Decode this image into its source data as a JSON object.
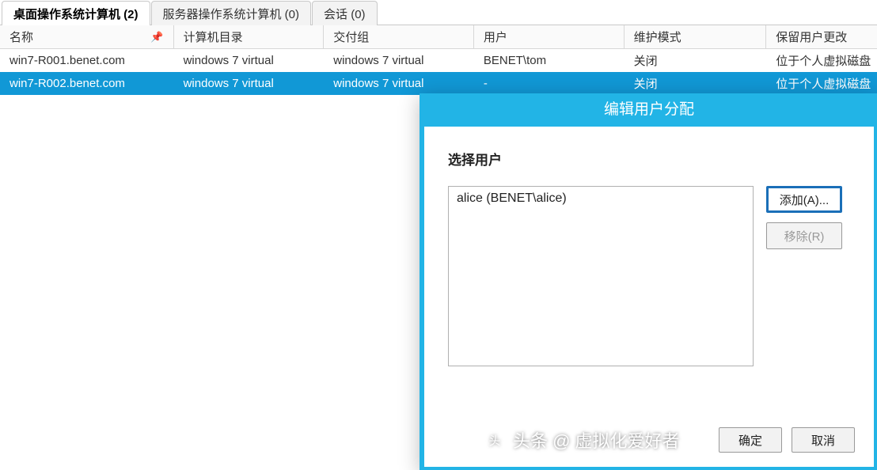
{
  "tabs": {
    "desktop": "桌面操作系统计算机 (2)",
    "server": "服务器操作系统计算机 (0)",
    "session": "会话 (0)"
  },
  "columns": {
    "name": "名称",
    "catalog": "计算机目录",
    "delivery": "交付组",
    "user": "用户",
    "maint": "维护模式",
    "retain": "保留用户更改"
  },
  "rows": [
    {
      "name": "win7-R001.benet.com",
      "catalog": "windows 7 virtual",
      "delivery": "windows 7 virtual",
      "user": "BENET\\tom",
      "maint": "关闭",
      "retain": "位于个人虚拟磁盘"
    },
    {
      "name": "win7-R002.benet.com",
      "catalog": "windows 7 virtual",
      "delivery": "windows 7 virtual",
      "user": "-",
      "maint": "关闭",
      "retain": "位于个人虚拟磁盘"
    }
  ],
  "dialog": {
    "title": "编辑用户分配",
    "section": "选择用户",
    "list_item": "alice (BENET\\alice)",
    "add": "添加(A)...",
    "remove": "移除(R)",
    "ok": "确定",
    "cancel": "取消"
  },
  "watermark": "头条 @ 虚拟化爱好者"
}
